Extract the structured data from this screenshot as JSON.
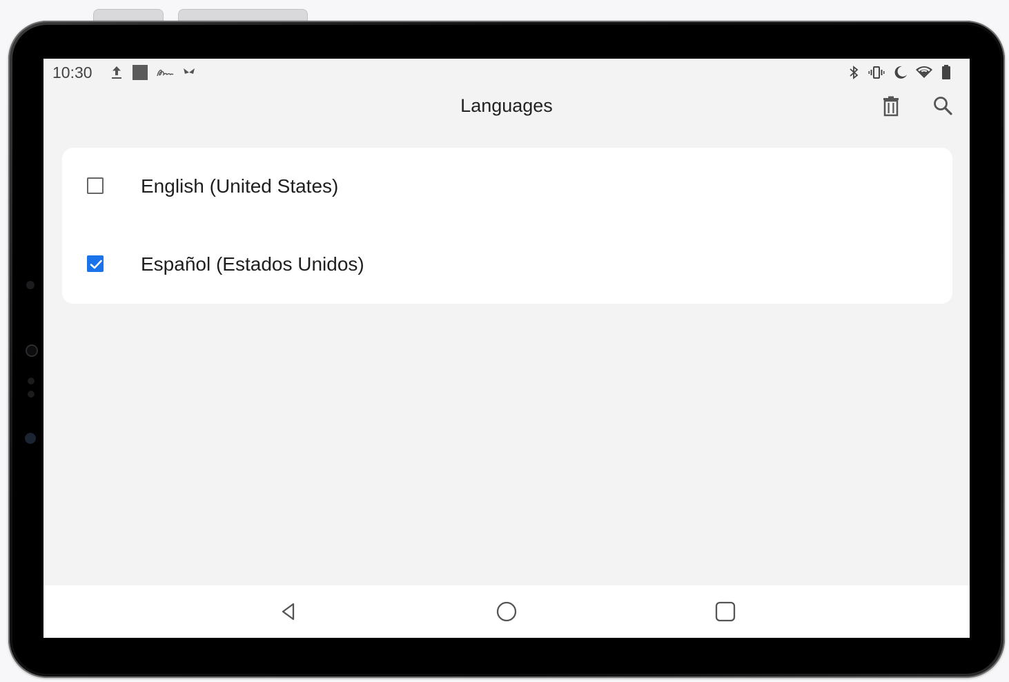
{
  "status_bar": {
    "time": "10:30",
    "left_icons": [
      "upload-icon",
      "square-notification-icon",
      "signature-icon",
      "butterfly-icon"
    ],
    "right_icons": [
      "bluetooth-icon",
      "vibrate-icon",
      "do-not-disturb-moon-icon",
      "wifi-icon",
      "battery-icon"
    ]
  },
  "app_bar": {
    "title": "Languages",
    "actions": [
      "trash-icon",
      "search-icon"
    ]
  },
  "languages": [
    {
      "label": "English (United States)",
      "checked": false
    },
    {
      "label": "Español (Estados Unidos)",
      "checked": true
    }
  ],
  "nav_bar": {
    "buttons": [
      "back-icon",
      "home-icon",
      "recents-icon"
    ]
  },
  "colors": {
    "accent": "#1a73e8",
    "screen_bg": "#f3f3f3",
    "card_bg": "#ffffff"
  }
}
